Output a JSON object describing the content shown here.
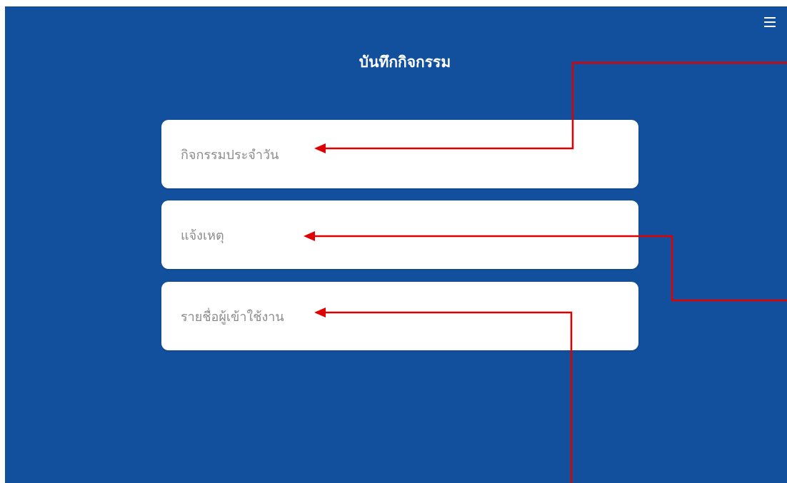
{
  "header": {
    "title": "บันทึกกิจกรรม",
    "menu_icon": "hamburger-menu-icon"
  },
  "menu": {
    "items": [
      {
        "label": "กิจกรรมประจำวัน"
      },
      {
        "label": "แจ้งเหตุ"
      },
      {
        "label": "รายชื่อผู้เข้าใช้งาน"
      }
    ]
  },
  "colors": {
    "background": "#124f9d",
    "card": "#ffffff",
    "card_text": "#8c8c8c",
    "annotation_arrow": "#e00000"
  }
}
